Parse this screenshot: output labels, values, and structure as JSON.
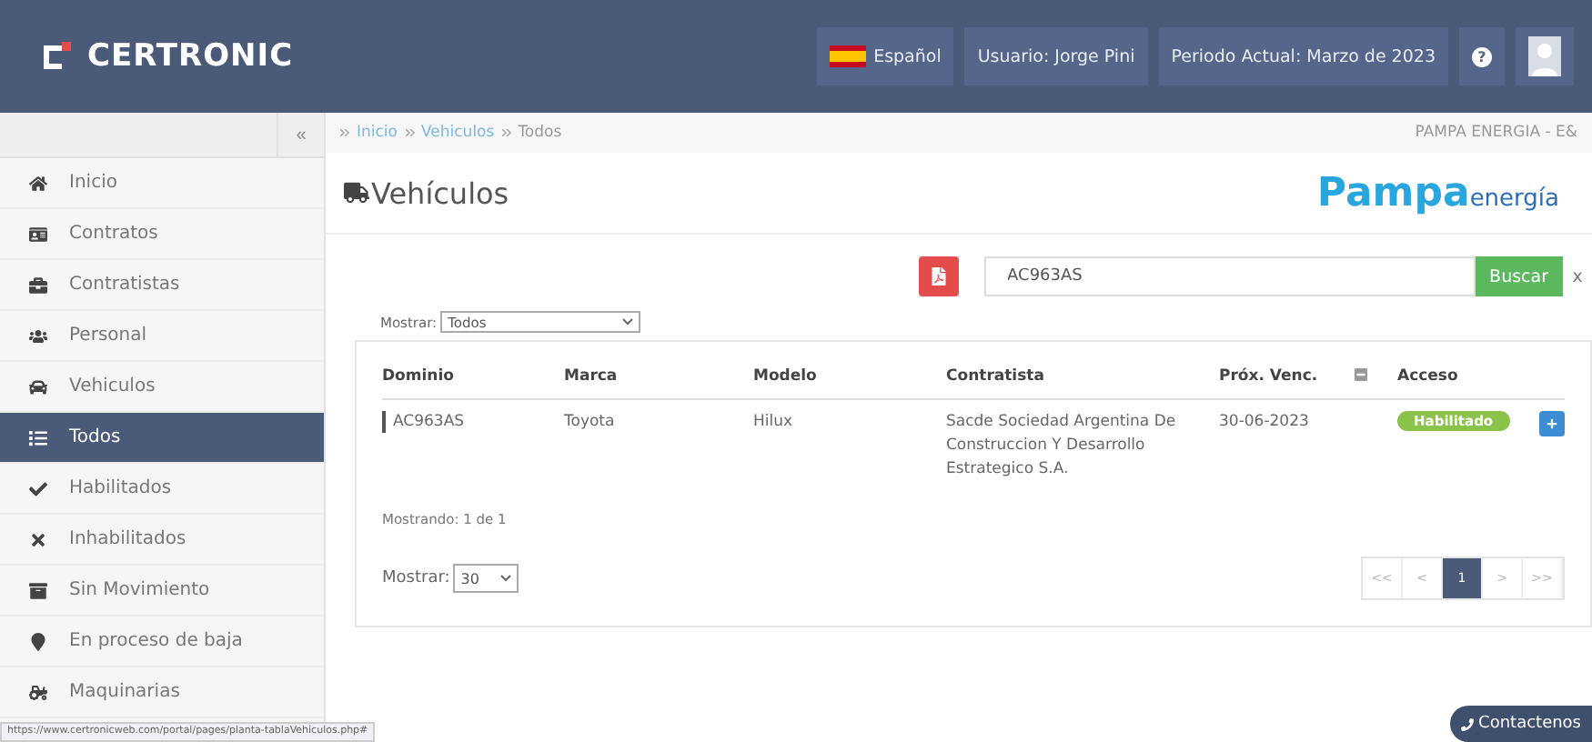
{
  "header": {
    "brand": "CERTRONIC",
    "language": "Español",
    "user": "Usuario: Jorge Pini",
    "period": "Periodo Actual: Marzo de 2023",
    "help": "?"
  },
  "sidebar": {
    "collapse": "«",
    "items": [
      {
        "label": "Inicio",
        "selected": false
      },
      {
        "label": "Contratos",
        "selected": false
      },
      {
        "label": "Contratistas",
        "selected": false
      },
      {
        "label": "Personal",
        "selected": false
      },
      {
        "label": "Vehiculos",
        "selected": false
      },
      {
        "label": "Todos",
        "selected": true
      },
      {
        "label": "Habilitados",
        "selected": false
      },
      {
        "label": "Inhabilitados",
        "selected": false
      },
      {
        "label": "Sin Movimiento",
        "selected": false
      },
      {
        "label": "En proceso de baja",
        "selected": false
      },
      {
        "label": "Maquinarias",
        "selected": false
      }
    ]
  },
  "breadcrumb": [
    {
      "label": "Inicio",
      "link": true
    },
    {
      "label": "Vehiculos",
      "link": true
    },
    {
      "label": "Todos",
      "link": false
    }
  ],
  "company": "PAMPA ENERGIA - E&",
  "page_title": "Vehículos",
  "logo": {
    "part_1": "Pampa",
    "part_2": "energía"
  },
  "search": {
    "value": "AC963AS",
    "button": "Buscar",
    "clear": "x"
  },
  "filter": {
    "label": "Mostrar:",
    "value": "Todos"
  },
  "table": {
    "columns": [
      "Dominio",
      "Marca",
      "Modelo",
      "Contratista",
      "Próx. Venc.",
      "Acceso"
    ],
    "rows": [
      {
        "dominio": "AC963AS",
        "marca": "Toyota",
        "modelo": "Hilux",
        "contratista": "Sacde Sociedad Argentina De Construccion Y Desarrollo Estrategico S.A.",
        "venc": "30-06-2023",
        "acceso": "Habilitado",
        "enabled": true
      }
    ]
  },
  "showing": "Mostrando: 1 de 1",
  "page_size": {
    "label": "Mostrar:",
    "value": "30"
  },
  "pagination": [
    {
      "label": "<<",
      "selected": false
    },
    {
      "label": "<",
      "selected": false
    },
    {
      "label": "1",
      "selected": true
    },
    {
      "label": ">",
      "selected": false
    },
    {
      "label": ">>",
      "selected": false
    }
  ],
  "contact": "Contactenos",
  "status_url": "https://www.certronicweb.com/portal/pages/planta-tablaVehiculos.php#"
}
